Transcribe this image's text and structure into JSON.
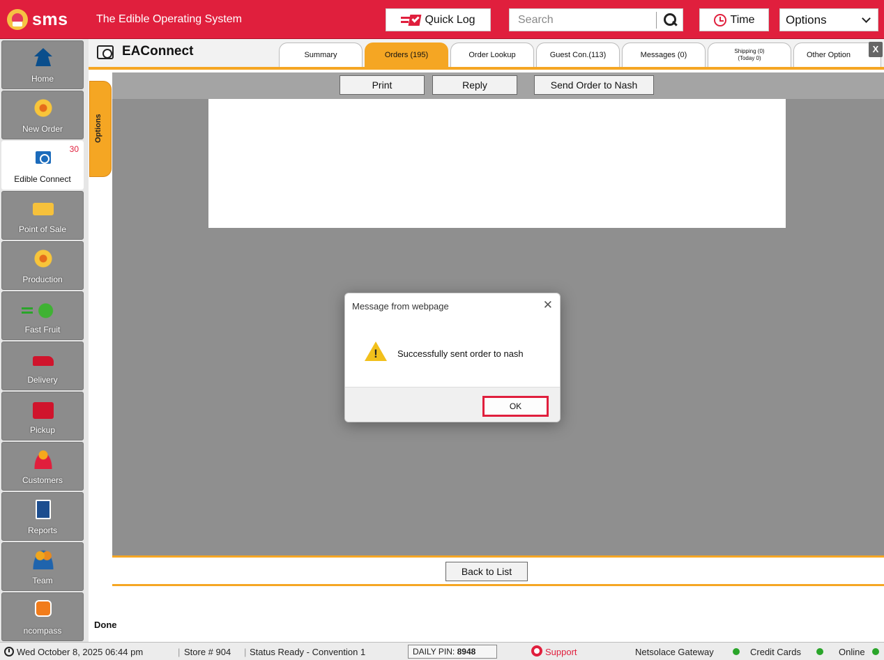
{
  "header": {
    "logo_text": "sms",
    "tagline": "The Edible Operating System",
    "quick_log_label": "Quick Log",
    "search_placeholder": "Search",
    "time_label": "Time",
    "options_label": "Options"
  },
  "sidebar": {
    "items": [
      {
        "label": "Home",
        "icon": "home-icon"
      },
      {
        "label": "New Order",
        "icon": "new-order-icon"
      },
      {
        "label": "Edible Connect",
        "icon": "edible-connect-icon",
        "badge": "30",
        "active": true
      },
      {
        "label": "Point of Sale",
        "icon": "folder-icon"
      },
      {
        "label": "Production",
        "icon": "flower-icon"
      },
      {
        "label": "Fast Fruit",
        "icon": "apple-icon"
      },
      {
        "label": "Delivery",
        "icon": "truck-icon"
      },
      {
        "label": "Pickup",
        "icon": "bag-icon"
      },
      {
        "label": "Customers",
        "icon": "person-icon"
      },
      {
        "label": "Reports",
        "icon": "report-icon"
      },
      {
        "label": "Team",
        "icon": "team-icon"
      },
      {
        "label": "ncompass",
        "icon": "compass-icon"
      }
    ]
  },
  "app": {
    "title": "EAConnect",
    "tabs": [
      {
        "label": "Summary"
      },
      {
        "label": "Orders (195)",
        "active": true
      },
      {
        "label": "Order Lookup"
      },
      {
        "label": "Guest Con.(113)"
      },
      {
        "label": "Messages (0)"
      },
      {
        "label_line1": "Shipping (0)",
        "label_line2": "(Today 0)"
      },
      {
        "label": "Other Option"
      }
    ],
    "close_label": "X",
    "options_tab_label": "Options",
    "actions": {
      "print": "Print",
      "reply": "Reply",
      "send_to_nash": "Send Order to Nash"
    },
    "back_to_list": "Back to List",
    "done_text": "Done"
  },
  "dialog": {
    "title": "Message from webpage",
    "close": "✕",
    "icon": "warning-icon",
    "message": "Successfully sent order to nash",
    "ok_label": "OK"
  },
  "statusbar": {
    "datetime": "Wed October 8, 2025  06:44 pm",
    "store": "Store #  904",
    "status": "Status  Ready - Convention 1",
    "pin_label": "DAILY PIN:",
    "pin_value": "8948",
    "support": "Support",
    "gateway": "Netsolace Gateway",
    "credit_cards": "Credit Cards",
    "online": "Online",
    "indicator_color": "#2aa52a"
  },
  "colors": {
    "brand_red": "#e01f3d",
    "accent_orange": "#f5a623"
  }
}
